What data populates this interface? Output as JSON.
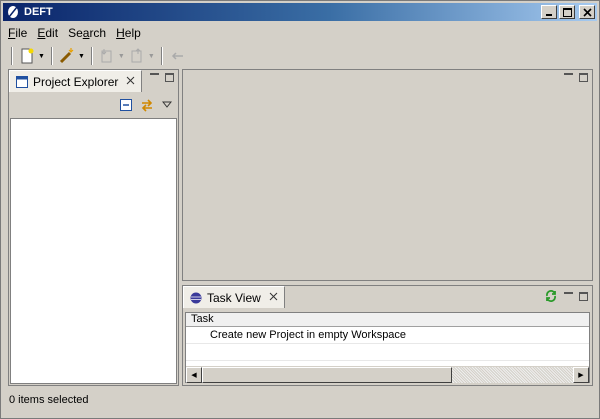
{
  "window": {
    "title": "DEFT",
    "app_icon": "feather-icon",
    "controls": [
      "minimize",
      "maximize",
      "close"
    ]
  },
  "menu": {
    "items": [
      {
        "label": "File",
        "mnemonic": "F"
      },
      {
        "label": "Edit",
        "mnemonic": "E"
      },
      {
        "label": "Search",
        "mnemonic": "a"
      },
      {
        "label": "Help",
        "mnemonic": "H"
      }
    ]
  },
  "toolbar": {
    "items": [
      {
        "icon": "new-icon",
        "dropdown": true,
        "enabled": true
      },
      {
        "icon": "wand-icon",
        "dropdown": true,
        "enabled": true
      },
      {
        "icon": "next-annotation-icon",
        "dropdown": true,
        "enabled": false
      },
      {
        "icon": "previous-annotation-icon",
        "dropdown": true,
        "enabled": false
      },
      {
        "icon": "back-icon",
        "dropdown": false,
        "enabled": false
      }
    ]
  },
  "project_explorer": {
    "tab_label": "Project Explorer",
    "tab_icon": "project-explorer-icon",
    "actions": [
      "collapse-all-icon",
      "link-with-editor-icon",
      "view-menu-icon"
    ]
  },
  "task_view": {
    "tab_label": "Task View",
    "tab_icon": "eclipse-icon",
    "refresh_icon": "refresh-icon",
    "column_header": "Task",
    "rows": [
      "Create new Project in empty Workspace"
    ]
  },
  "status": {
    "text": "0 items selected"
  },
  "colors": {
    "title_bar_start": "#0a246a",
    "title_bar_end": "#a6caf0",
    "chrome": "#d4d0c8"
  }
}
